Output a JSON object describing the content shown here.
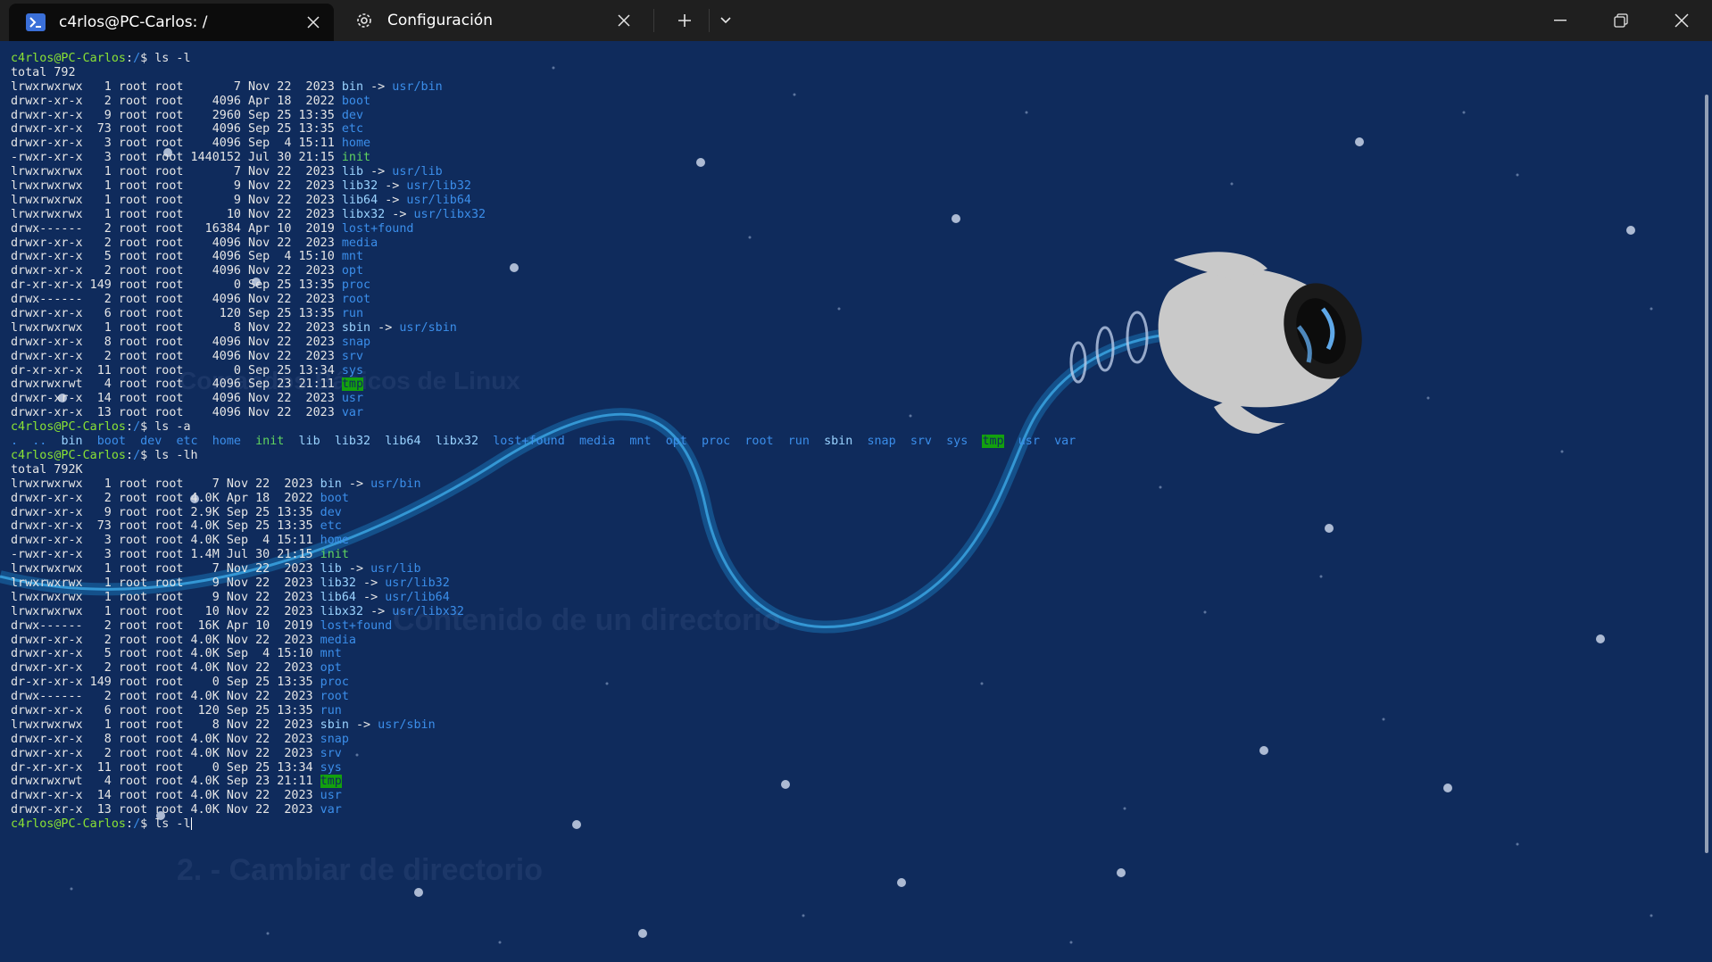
{
  "tabs": [
    {
      "label": "c4rlos@PC-Carlos: /",
      "icon": "terminal-icon",
      "active": true
    },
    {
      "label": "Configuración",
      "icon": "gear-icon",
      "active": false
    }
  ],
  "titlebar": {
    "new_tab_icon": "plus-icon",
    "dropdown_icon": "chevron-down-icon",
    "minimize_icon": "minimize-icon",
    "restore_icon": "restore-icon",
    "close_icon": "close-icon"
  },
  "colors": {
    "background": "#0f2b5c",
    "titlebar": "#1f1f1f",
    "prompt": "#8ae234",
    "directory": "#3b8eea",
    "highlight": "#13a10e"
  },
  "terminal": {
    "lines": [
      {
        "t": "prompt",
        "user": "c4rlos@PC-Carlos",
        "path": "/",
        "cmd": "ls -l"
      },
      {
        "t": "text",
        "text": "total 792"
      },
      {
        "t": "entry",
        "perm": "lrwxrwxrwx",
        "n": "  1",
        "owner": "root root",
        "size": "      7",
        "date": "Nov 22  2023",
        "name": "bin",
        "link": "usr/bin"
      },
      {
        "t": "entry",
        "perm": "drwxr-xr-x",
        "n": "  2",
        "owner": "root root",
        "size": "   4096",
        "date": "Apr 18  2022",
        "name": "boot"
      },
      {
        "t": "entry",
        "perm": "drwxr-xr-x",
        "n": "  9",
        "owner": "root root",
        "size": "   2960",
        "date": "Sep 25 13:35",
        "name": "dev"
      },
      {
        "t": "entry",
        "perm": "drwxr-xr-x",
        "n": " 73",
        "owner": "root root",
        "size": "   4096",
        "date": "Sep 25 13:35",
        "name": "etc"
      },
      {
        "t": "entry",
        "perm": "drwxr-xr-x",
        "n": "  3",
        "owner": "root root",
        "size": "   4096",
        "date": "Sep  4 15:11",
        "name": "home"
      },
      {
        "t": "entry",
        "perm": "-rwxr-xr-x",
        "n": "  3",
        "owner": "root root",
        "size": "1440152",
        "date": "Jul 30 21:15",
        "name": "init",
        "kind": "exe"
      },
      {
        "t": "entry",
        "perm": "lrwxrwxrwx",
        "n": "  1",
        "owner": "root root",
        "size": "      7",
        "date": "Nov 22  2023",
        "name": "lib",
        "link": "usr/lib"
      },
      {
        "t": "entry",
        "perm": "lrwxrwxrwx",
        "n": "  1",
        "owner": "root root",
        "size": "      9",
        "date": "Nov 22  2023",
        "name": "lib32",
        "link": "usr/lib32"
      },
      {
        "t": "entry",
        "perm": "lrwxrwxrwx",
        "n": "  1",
        "owner": "root root",
        "size": "      9",
        "date": "Nov 22  2023",
        "name": "lib64",
        "link": "usr/lib64"
      },
      {
        "t": "entry",
        "perm": "lrwxrwxrwx",
        "n": "  1",
        "owner": "root root",
        "size": "     10",
        "date": "Nov 22  2023",
        "name": "libx32",
        "link": "usr/libx32"
      },
      {
        "t": "entry",
        "perm": "drwx------",
        "n": "  2",
        "owner": "root root",
        "size": "  16384",
        "date": "Apr 10  2019",
        "name": "lost+found"
      },
      {
        "t": "entry",
        "perm": "drwxr-xr-x",
        "n": "  2",
        "owner": "root root",
        "size": "   4096",
        "date": "Nov 22  2023",
        "name": "media"
      },
      {
        "t": "entry",
        "perm": "drwxr-xr-x",
        "n": "  5",
        "owner": "root root",
        "size": "   4096",
        "date": "Sep  4 15:10",
        "name": "mnt"
      },
      {
        "t": "entry",
        "perm": "drwxr-xr-x",
        "n": "  2",
        "owner": "root root",
        "size": "   4096",
        "date": "Nov 22  2023",
        "name": "opt"
      },
      {
        "t": "entry",
        "perm": "dr-xr-xr-x",
        "n": "149",
        "owner": "root root",
        "size": "      0",
        "date": "Sep 25 13:35",
        "name": "proc"
      },
      {
        "t": "entry",
        "perm": "drwx------",
        "n": "  2",
        "owner": "root root",
        "size": "   4096",
        "date": "Nov 22  2023",
        "name": "root"
      },
      {
        "t": "entry",
        "perm": "drwxr-xr-x",
        "n": "  6",
        "owner": "root root",
        "size": "    120",
        "date": "Sep 25 13:35",
        "name": "run"
      },
      {
        "t": "entry",
        "perm": "lrwxrwxrwx",
        "n": "  1",
        "owner": "root root",
        "size": "      8",
        "date": "Nov 22  2023",
        "name": "sbin",
        "link": "usr/sbin"
      },
      {
        "t": "entry",
        "perm": "drwxr-xr-x",
        "n": "  8",
        "owner": "root root",
        "size": "   4096",
        "date": "Nov 22  2023",
        "name": "snap"
      },
      {
        "t": "entry",
        "perm": "drwxr-xr-x",
        "n": "  2",
        "owner": "root root",
        "size": "   4096",
        "date": "Nov 22  2023",
        "name": "srv"
      },
      {
        "t": "entry",
        "perm": "dr-xr-xr-x",
        "n": " 11",
        "owner": "root root",
        "size": "      0",
        "date": "Sep 25 13:34",
        "name": "sys"
      },
      {
        "t": "entry",
        "perm": "drwxrwxrwt",
        "n": "  4",
        "owner": "root root",
        "size": "   4096",
        "date": "Sep 23 21:11",
        "name": "tmp",
        "kind": "tmp"
      },
      {
        "t": "entry",
        "perm": "drwxr-xr-x",
        "n": " 14",
        "owner": "root root",
        "size": "   4096",
        "date": "Nov 22  2023",
        "name": "usr"
      },
      {
        "t": "entry",
        "perm": "drwxr-xr-x",
        "n": " 13",
        "owner": "root root",
        "size": "   4096",
        "date": "Nov 22  2023",
        "name": "var"
      },
      {
        "t": "prompt",
        "user": "c4rlos@PC-Carlos",
        "path": "/",
        "cmd": "ls -a"
      },
      {
        "t": "list",
        "items": [
          ".",
          "..",
          "bin",
          "boot",
          "dev",
          "etc",
          "home",
          "init",
          "lib",
          "lib32",
          "lib64",
          "libx32",
          "lost+found",
          "media",
          "mnt",
          "opt",
          "proc",
          "root",
          "run",
          "sbin",
          "snap",
          "srv",
          "sys",
          "tmp",
          "usr",
          "var"
        ]
      },
      {
        "t": "prompt",
        "user": "c4rlos@PC-Carlos",
        "path": "/",
        "cmd": "ls -lh"
      },
      {
        "t": "text",
        "text": "total 792K"
      },
      {
        "t": "entry",
        "perm": "lrwxrwxrwx",
        "n": "  1",
        "owner": "root root",
        "size": "   7",
        "date": "Nov 22  2023",
        "name": "bin",
        "link": "usr/bin"
      },
      {
        "t": "entry",
        "perm": "drwxr-xr-x",
        "n": "  2",
        "owner": "root root",
        "size": "4.0K",
        "date": "Apr 18  2022",
        "name": "boot"
      },
      {
        "t": "entry",
        "perm": "drwxr-xr-x",
        "n": "  9",
        "owner": "root root",
        "size": "2.9K",
        "date": "Sep 25 13:35",
        "name": "dev"
      },
      {
        "t": "entry",
        "perm": "drwxr-xr-x",
        "n": " 73",
        "owner": "root root",
        "size": "4.0K",
        "date": "Sep 25 13:35",
        "name": "etc"
      },
      {
        "t": "entry",
        "perm": "drwxr-xr-x",
        "n": "  3",
        "owner": "root root",
        "size": "4.0K",
        "date": "Sep  4 15:11",
        "name": "home"
      },
      {
        "t": "entry",
        "perm": "-rwxr-xr-x",
        "n": "  3",
        "owner": "root root",
        "size": "1.4M",
        "date": "Jul 30 21:15",
        "name": "init",
        "kind": "exe"
      },
      {
        "t": "entry",
        "perm": "lrwxrwxrwx",
        "n": "  1",
        "owner": "root root",
        "size": "   7",
        "date": "Nov 22  2023",
        "name": "lib",
        "link": "usr/lib"
      },
      {
        "t": "entry",
        "perm": "lrwxrwxrwx",
        "n": "  1",
        "owner": "root root",
        "size": "   9",
        "date": "Nov 22  2023",
        "name": "lib32",
        "link": "usr/lib32"
      },
      {
        "t": "entry",
        "perm": "lrwxrwxrwx",
        "n": "  1",
        "owner": "root root",
        "size": "   9",
        "date": "Nov 22  2023",
        "name": "lib64",
        "link": "usr/lib64"
      },
      {
        "t": "entry",
        "perm": "lrwxrwxrwx",
        "n": "  1",
        "owner": "root root",
        "size": "  10",
        "date": "Nov 22  2023",
        "name": "libx32",
        "link": "usr/libx32"
      },
      {
        "t": "entry",
        "perm": "drwx------",
        "n": "  2",
        "owner": "root root",
        "size": " 16K",
        "date": "Apr 10  2019",
        "name": "lost+found"
      },
      {
        "t": "entry",
        "perm": "drwxr-xr-x",
        "n": "  2",
        "owner": "root root",
        "size": "4.0K",
        "date": "Nov 22  2023",
        "name": "media"
      },
      {
        "t": "entry",
        "perm": "drwxr-xr-x",
        "n": "  5",
        "owner": "root root",
        "size": "4.0K",
        "date": "Sep  4 15:10",
        "name": "mnt"
      },
      {
        "t": "entry",
        "perm": "drwxr-xr-x",
        "n": "  2",
        "owner": "root root",
        "size": "4.0K",
        "date": "Nov 22  2023",
        "name": "opt"
      },
      {
        "t": "entry",
        "perm": "dr-xr-xr-x",
        "n": "149",
        "owner": "root root",
        "size": "   0",
        "date": "Sep 25 13:35",
        "name": "proc"
      },
      {
        "t": "entry",
        "perm": "drwx------",
        "n": "  2",
        "owner": "root root",
        "size": "4.0K",
        "date": "Nov 22  2023",
        "name": "root"
      },
      {
        "t": "entry",
        "perm": "drwxr-xr-x",
        "n": "  6",
        "owner": "root root",
        "size": " 120",
        "date": "Sep 25 13:35",
        "name": "run"
      },
      {
        "t": "entry",
        "perm": "lrwxrwxrwx",
        "n": "  1",
        "owner": "root root",
        "size": "   8",
        "date": "Nov 22  2023",
        "name": "sbin",
        "link": "usr/sbin"
      },
      {
        "t": "entry",
        "perm": "drwxr-xr-x",
        "n": "  8",
        "owner": "root root",
        "size": "4.0K",
        "date": "Nov 22  2023",
        "name": "snap"
      },
      {
        "t": "entry",
        "perm": "drwxr-xr-x",
        "n": "  2",
        "owner": "root root",
        "size": "4.0K",
        "date": "Nov 22  2023",
        "name": "srv"
      },
      {
        "t": "entry",
        "perm": "dr-xr-xr-x",
        "n": " 11",
        "owner": "root root",
        "size": "   0",
        "date": "Sep 25 13:34",
        "name": "sys"
      },
      {
        "t": "entry",
        "perm": "drwxrwxrwt",
        "n": "  4",
        "owner": "root root",
        "size": "4.0K",
        "date": "Sep 23 21:11",
        "name": "tmp",
        "kind": "tmp"
      },
      {
        "t": "entry",
        "perm": "drwxr-xr-x",
        "n": " 14",
        "owner": "root root",
        "size": "4.0K",
        "date": "Nov 22  2023",
        "name": "usr"
      },
      {
        "t": "entry",
        "perm": "drwxr-xr-x",
        "n": " 13",
        "owner": "root root",
        "size": "4.0K",
        "date": "Nov 22  2023",
        "name": "var"
      },
      {
        "t": "prompt",
        "user": "c4rlos@PC-Carlos",
        "path": "/",
        "cmd": "ls -l",
        "cursor": true
      }
    ]
  },
  "background_ghost": {
    "heading1": "Comandos Básicos de Linux",
    "heading2": "Contenido de un directorio",
    "heading3": "2.      - Cambiar de directorio"
  }
}
